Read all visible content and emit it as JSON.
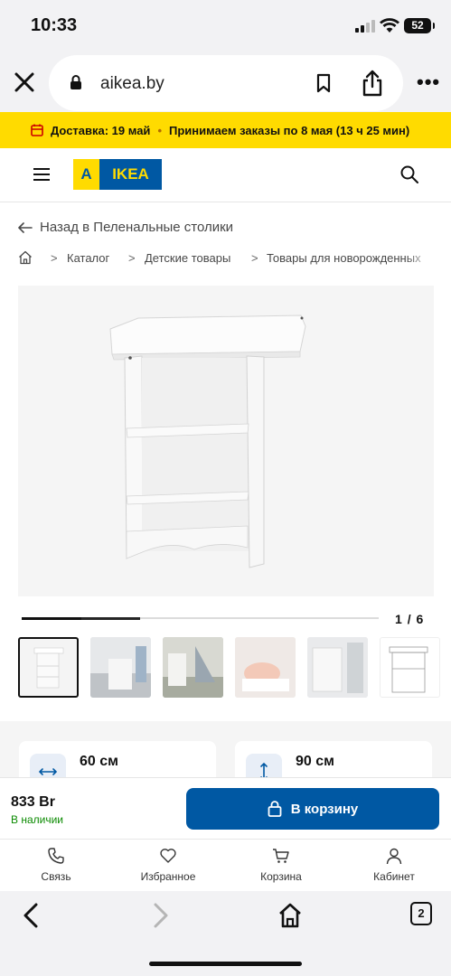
{
  "status_bar": {
    "time": "10:33",
    "battery": "52"
  },
  "browser": {
    "url": "aikea.by"
  },
  "banner": {
    "delivery": "Доставка: 19 май",
    "separator": "•",
    "orders": "Принимаем заказы по 8 мая (13 ч 25 мин)"
  },
  "header": {
    "logo_a": "A",
    "logo_text": "IKEA"
  },
  "back_link": "Назад в Пеленальные столики",
  "breadcrumb": {
    "separator": ">",
    "items": [
      "Каталог",
      "Детские товары",
      "Товары для новорожденных"
    ]
  },
  "gallery": {
    "current": "1",
    "separator": "/",
    "total": "6",
    "progress": 0.166
  },
  "dimensions": [
    {
      "value": "60 см",
      "icon": "width-arrows-icon"
    },
    {
      "value": "90 см",
      "icon": "height-arrows-icon"
    }
  ],
  "purchase": {
    "price": "833 Br",
    "stock": "В наличии",
    "cart_label": "В корзину"
  },
  "nav": [
    {
      "label": "Связь",
      "icon": "phone-icon"
    },
    {
      "label": "Избранное",
      "icon": "heart-icon"
    },
    {
      "label": "Корзина",
      "icon": "cart-icon"
    },
    {
      "label": "Кабинет",
      "icon": "user-icon"
    }
  ],
  "browser_toolbar": {
    "tabs": "2"
  },
  "colors": {
    "brand_blue": "#0058a3",
    "brand_yellow": "#ffdb00",
    "stock_green": "#0a8a00"
  }
}
